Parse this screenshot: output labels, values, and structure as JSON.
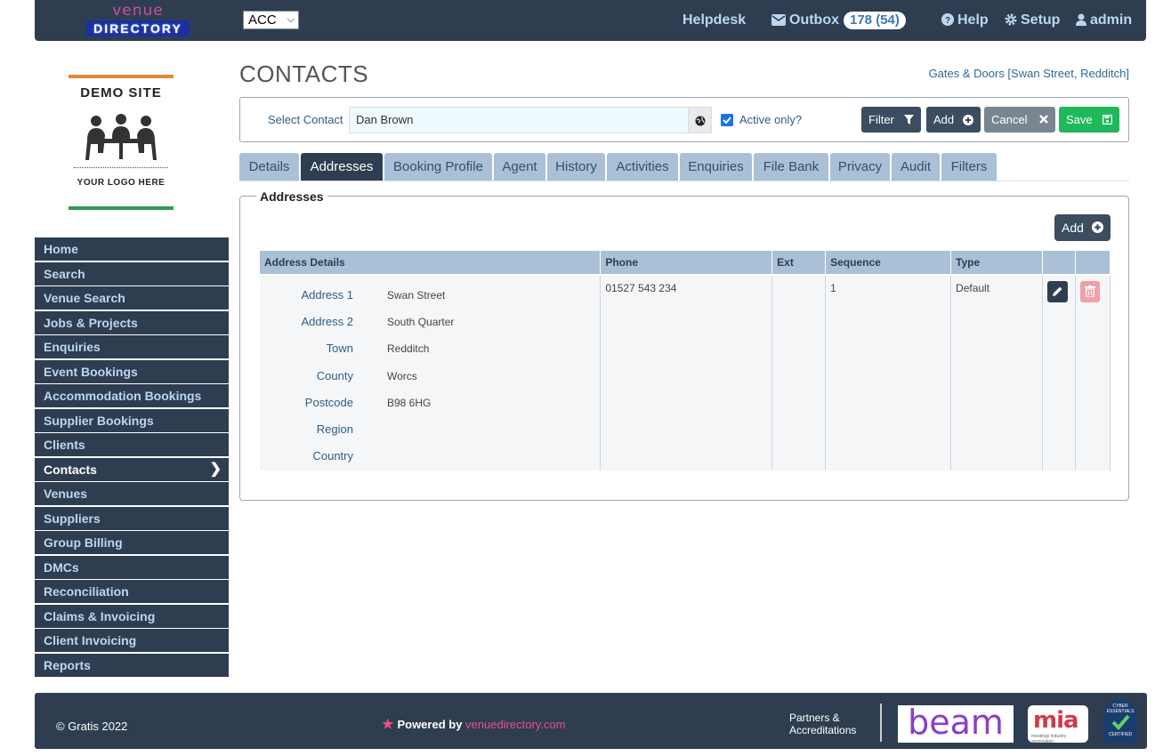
{
  "header": {
    "logo_line1": "venue",
    "logo_line2": "DIRECTORY",
    "account_select": "ACC",
    "helpdesk": "Helpdesk",
    "outbox": "Outbox",
    "outbox_count": "178 (54)",
    "help": "Help",
    "setup": "Setup",
    "user": "admin"
  },
  "demo_logo": {
    "title": "DEMO SITE",
    "subtitle": "YOUR LOGO HERE"
  },
  "sidebar": {
    "items": [
      {
        "label": "Home"
      },
      {
        "label": "Search"
      },
      {
        "label": "Venue Search"
      },
      {
        "label": "Jobs & Projects"
      },
      {
        "label": "Enquiries"
      },
      {
        "label": "Event Bookings"
      },
      {
        "label": "Accommodation Bookings"
      },
      {
        "label": "Supplier Bookings"
      },
      {
        "label": "Clients"
      },
      {
        "label": "Contacts",
        "active": true
      },
      {
        "label": "Venues"
      },
      {
        "label": "Suppliers"
      },
      {
        "label": "Group Billing"
      },
      {
        "label": "DMCs"
      },
      {
        "label": "Reconciliation"
      },
      {
        "label": "Claims & Invoicing"
      },
      {
        "label": "Client Invoicing"
      },
      {
        "label": "Reports"
      }
    ]
  },
  "page": {
    "title": "CONTACTS",
    "breadcrumb": "Gates & Doors [Swan Street, Redditch]"
  },
  "contact_bar": {
    "label": "Select Contact",
    "value": "Dan Brown",
    "active_only_label": "Active only?",
    "active_only_checked": true,
    "filter": "Filter",
    "add": "Add",
    "cancel": "Cancel",
    "save": "Save"
  },
  "tabs": [
    {
      "label": "Details"
    },
    {
      "label": "Addresses",
      "active": true
    },
    {
      "label": "Booking Profile"
    },
    {
      "label": "Agent"
    },
    {
      "label": "History"
    },
    {
      "label": "Activities"
    },
    {
      "label": "Enquiries"
    },
    {
      "label": "File Bank"
    },
    {
      "label": "Privacy"
    },
    {
      "label": "Audit"
    },
    {
      "label": "Filters"
    }
  ],
  "addresses": {
    "legend": "Addresses",
    "add": "Add",
    "columns": [
      "Address Details",
      "Phone",
      "Ext",
      "Sequence",
      "Type"
    ],
    "rows": [
      {
        "details": [
          {
            "key": "Address 1",
            "value": "Swan Street"
          },
          {
            "key": "Address 2",
            "value": "South Quarter"
          },
          {
            "key": "Town",
            "value": "Redditch"
          },
          {
            "key": "County",
            "value": "Worcs"
          },
          {
            "key": "Postcode",
            "value": "B98 6HG"
          },
          {
            "key": "Region",
            "value": ""
          },
          {
            "key": "Country",
            "value": ""
          }
        ],
        "phone": "01527 543 234",
        "ext": "",
        "sequence": "1",
        "type": "Default"
      }
    ]
  },
  "footer": {
    "copyright": "© Gratis 2022",
    "powered_by": "Powered by",
    "powered_brand": "venuedirectory.com",
    "partners_line1": "Partners &",
    "partners_line2": "Accreditations",
    "beam": "beam",
    "mia": "mia",
    "mia_sub": "meetings industry association",
    "cyber_top": "CYBER ESSENTIALS",
    "cyber_bottom": "CERTIFIED"
  }
}
